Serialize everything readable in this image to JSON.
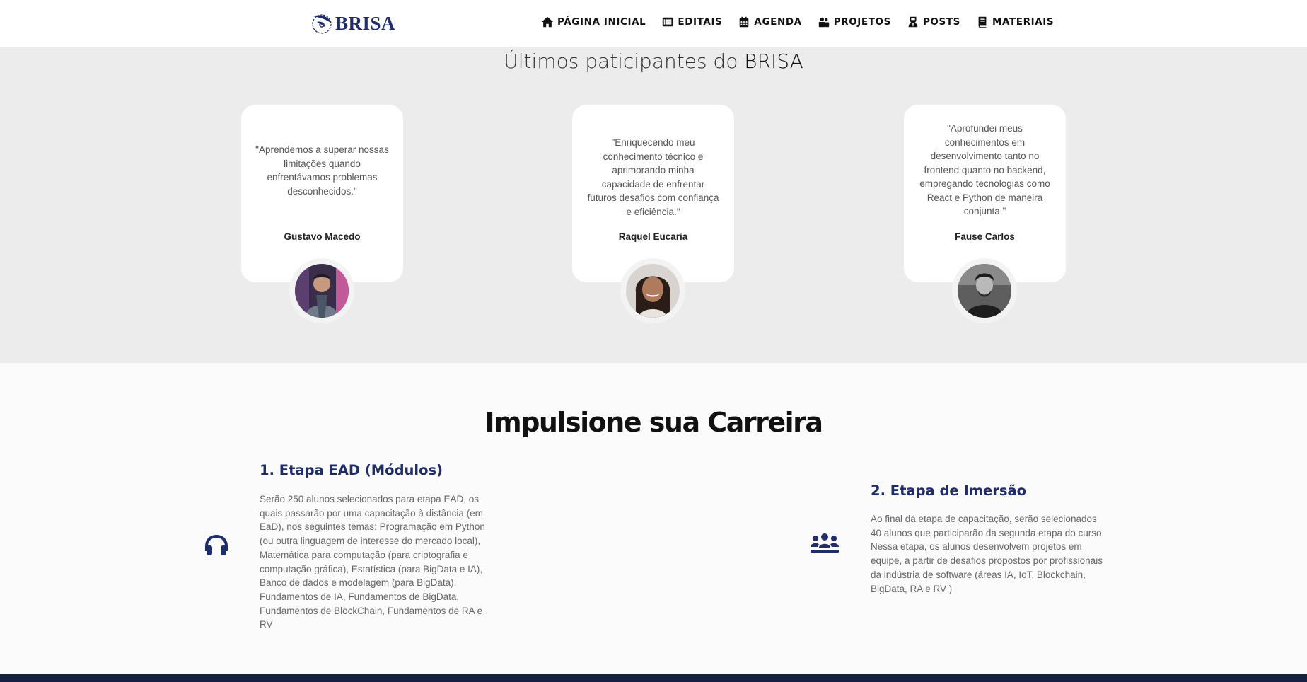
{
  "header": {
    "logo_text": "BRISA",
    "nav": [
      {
        "label": "PÁGINA INICIAL",
        "icon": "home-icon"
      },
      {
        "label": "EDITAIS",
        "icon": "list-icon"
      },
      {
        "label": "AGENDA",
        "icon": "calendar-icon"
      },
      {
        "label": "PROJETOS",
        "icon": "users-icon"
      },
      {
        "label": "POSTS",
        "icon": "user-tie-icon"
      },
      {
        "label": "MATERIAIS",
        "icon": "book-icon"
      }
    ]
  },
  "participants": {
    "title_prefix": "Últimos paticipantes do ",
    "title_brand": "BRISA",
    "cards": [
      {
        "quote": "\"Aprendemos a superar nossas limitações quando enfrentávamos problemas desconhecidos.\"",
        "name": "Gustavo Macedo"
      },
      {
        "quote": "\"Enriquecendo meu conhecimento técnico e aprimorando minha capacidade de enfrentar futuros desafios com confiança e eficiência.\"",
        "name": "Raquel Eucaria"
      },
      {
        "quote": "\"Aprofundei meus conhecimentos em desenvolvimento tanto no frontend quanto no backend, empregando tecnologias como React e Python de maneira conjunta.\"",
        "name": "Fause Carlos"
      }
    ]
  },
  "career": {
    "title": "Impulsione sua Carreira",
    "steps": [
      {
        "title": "1. Etapa EAD (Módulos)",
        "text": "Serão 250 alunos selecionados para etapa EAD, os quais passarão por uma capacitação à distância (em EaD), nos seguintes temas: Programação em Python (ou outra linguagem de interesse do mercado local), Matemática para computação (para criptografia e computação gráfica), Estatística (para BigData e IA), Banco de dados e modelagem (para BigData), Fundamentos de IA, Fundamentos de BigData, Fundamentos de BlockChain, Fundamentos de RA e RV",
        "icon": "headphones-icon"
      },
      {
        "title": "2. Etapa de Imersão",
        "text": "Ao final da etapa de capacitação, serão selecionados 40 alunos que participarão da segunda etapa do curso. Nessa etapa, os alunos desenvolvem projetos em equipe, a partir de desafios propostos por profissionais da indústria de software (áreas IA, IoT, Blockchain, BigData, RA e RV )",
        "icon": "group-icon"
      }
    ]
  },
  "colors": {
    "brand": "#1f2d6b",
    "section_bg": "#ececec",
    "footer": "#16213f"
  }
}
